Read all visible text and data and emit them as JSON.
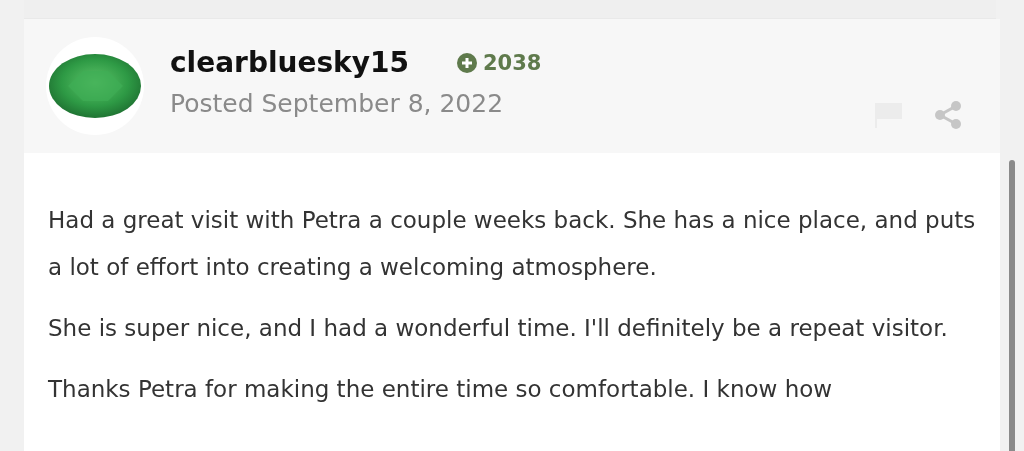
{
  "post": {
    "author": "clearbluesky15",
    "reputation": "2038",
    "posted": "Posted September 8, 2022",
    "paragraphs": [
      "Had a great visit with Petra a couple weeks back. She has a nice place, and puts a lot of effort into creating a welcoming atmosphere.",
      "She is super nice, and I had a wonderful time. I'll definitely be a repeat visitor.",
      "Thanks Petra for making the entire time so comfortable. I know how"
    ]
  }
}
